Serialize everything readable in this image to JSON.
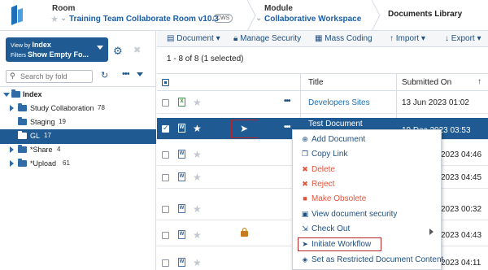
{
  "header": {
    "room_label": "Room",
    "room_name": "Training Team Collaborate Room v10.3",
    "room_badge": "CWS",
    "module_label": "Module",
    "module_name": "Collaborative Workspace",
    "page_title": "Documents Library"
  },
  "sidebar": {
    "viewby_label": "View by",
    "viewby_value": "Index",
    "filters_label": "Filters",
    "filters_value": "Show Empty Fo...",
    "search_placeholder": "Search by fold",
    "tree": [
      {
        "label": "Index",
        "count": ""
      },
      {
        "label": "Study Collaboration",
        "count": "78"
      },
      {
        "label": "Staging",
        "count": "19"
      },
      {
        "label": "GL",
        "count": "17"
      },
      {
        "label": "*Share",
        "count": "4"
      },
      {
        "label": "*Upload",
        "count": "61"
      }
    ]
  },
  "toolbar": {
    "document": "Document",
    "manage_security": "Manage Security",
    "mass_coding": "Mass Coding",
    "import": "Import",
    "export": "Export"
  },
  "summary": "1 - 8 of 8 (1 selected)",
  "table": {
    "columns": {
      "title": "Title",
      "submitted_on": "Submitted On"
    },
    "rows": [
      {
        "type": "xl",
        "title": "Developers Sites",
        "date": "13 Jun 2023 01:02",
        "selected": false
      },
      {
        "type": "w",
        "title": "Test Document",
        "date": "19 Dec 2023 03:53",
        "selected": true
      },
      {
        "type": "w",
        "title": "",
        "date": "2023 04:46",
        "selected": false
      },
      {
        "type": "w",
        "title": "",
        "date": "2023 04:45",
        "selected": false
      },
      {
        "type": "w",
        "title": "",
        "date": "2023 00:32",
        "selected": false
      },
      {
        "type": "w",
        "title": "",
        "date": "2023 04:43",
        "selected": false
      },
      {
        "type": "w",
        "title": "",
        "date": "2023 04:11",
        "selected": false
      }
    ]
  },
  "context_menu": {
    "add_document": "Add Document",
    "copy_link": "Copy Link",
    "delete": "Delete",
    "reject": "Reject",
    "make_obsolete": "Make Obsolete",
    "view_security": "View document security",
    "check_out": "Check Out",
    "initiate_workflow": "Initiate Workflow",
    "set_restricted": "Set as Restricted Document Content"
  },
  "colors": {
    "accent": "#1f5b92",
    "link": "#1a6fb5",
    "danger": "#e0533a",
    "highlight": "#b5262b"
  }
}
